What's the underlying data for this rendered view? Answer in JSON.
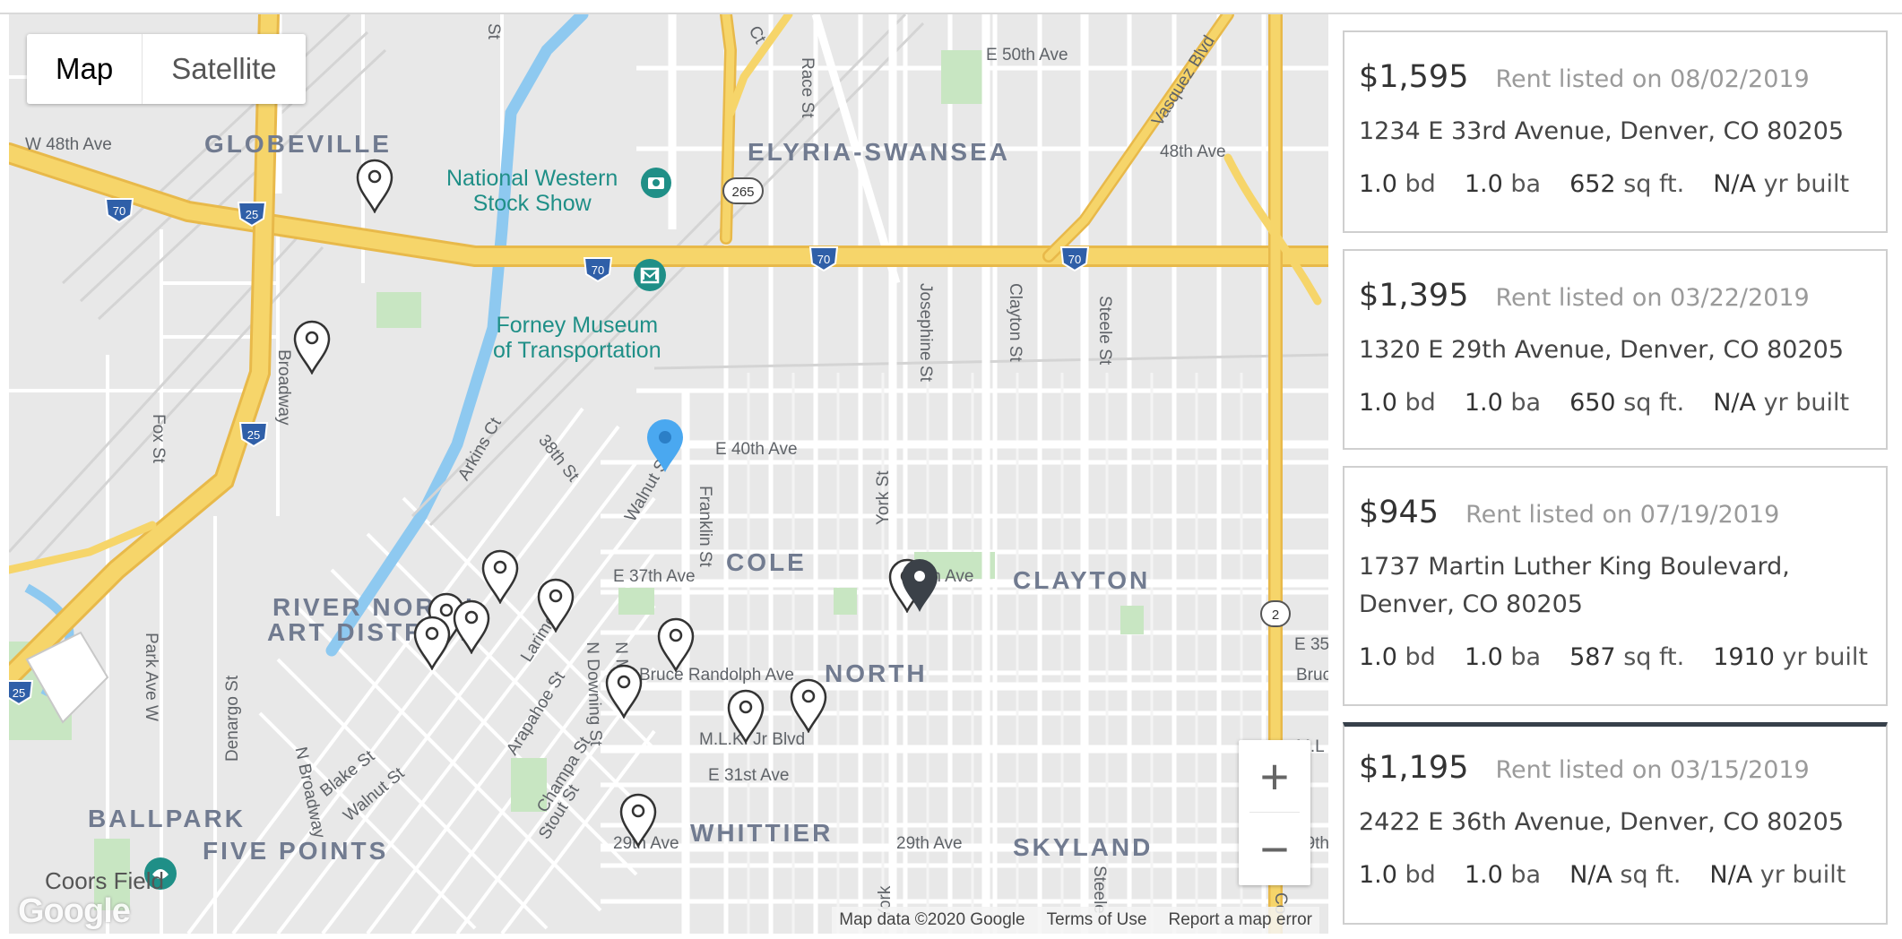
{
  "map": {
    "type_buttons": [
      "Map",
      "Satellite"
    ],
    "active_type": "Map",
    "zoom": {
      "in_label": "+",
      "out_label": "−"
    },
    "attribution": {
      "data": "Map data ©2020 Google",
      "terms": "Terms of Use",
      "report": "Report a map error"
    },
    "logo": "Google",
    "neighborhoods": {
      "globeville": "GLOBEVILLE",
      "elyria": "ELYRIA-SWANSEA",
      "cole": "COLE",
      "clayton": "CLAYTON",
      "north": "NORTH",
      "river1": "RIVER NORTH",
      "river2": "ART DISTRICT",
      "ballpark": "BALLPARK",
      "fivepoints": "FIVE POINTS",
      "whittier": "WHITTIER",
      "skyland": "SKYLAND"
    },
    "poi": {
      "nwss1": "National Western",
      "nwss2": "Stock Show",
      "forney1": "Forney Museum",
      "forney2": "of Transportation",
      "coors": "Coors Field"
    },
    "streets": {
      "e50": "E 50th Ave",
      "w48": "W 48th Ave",
      "e48": "48th Ave",
      "vasquez": "Vasquez Blvd",
      "e40": "E 40th Ave",
      "e37": "E 37th Ave",
      "e36": "th Ave",
      "bruce": "Bruce Randolph Ave",
      "mlk": "M.L.K. Jr Blvd",
      "e31": "E 31st Ave",
      "e29": "29th Ave",
      "e29b": "29th Ave",
      "e35": "E 35",
      "bruc": "Bruc",
      "mlk2": "M.L",
      "29th": "29th",
      "race": "Race St",
      "josephine": "Josephine St",
      "clayton_st": "Clayton St",
      "steele": "Steele St",
      "york": "York St",
      "york2": "York",
      "steele2": "Steele",
      "franklin": "Franklin St",
      "walnut": "Walnut St",
      "arkins": "Arkins Ct",
      "st38": "38th St",
      "broadway": "Broadway",
      "fox": "Fox St",
      "parkave": "Park Ave W",
      "denargo": "Denargo St",
      "nbroadway": "N Broadway",
      "blake": "Blake St",
      "walnut2": "Walnut St",
      "larimer": "Larimer",
      "arapahoe": "Arapahoe St",
      "champa": "Champa St",
      "stout": "Stout St",
      "ndowning": "N Downing St",
      "nm": "N M",
      "st": "St",
      "ct": "Ct",
      "co": "Co"
    },
    "shields": {
      "i70a": "70",
      "i70b": "70",
      "i70c": "70",
      "i70d": "70",
      "i25a": "25",
      "i25b": "25",
      "i25c": "25",
      "us265": "265",
      "co2": "2"
    }
  },
  "listings": [
    {
      "price": "$1,595",
      "listed": "Rent listed on 08/02/2019",
      "address": "1234 E 33rd Avenue, Denver, CO 80205",
      "bd": "1.0",
      "ba": "1.0",
      "sqft": "652",
      "year": "N/A",
      "bd_unit": "bd",
      "ba_unit": "ba",
      "sqft_unit": "sq ft.",
      "year_unit": "yr built"
    },
    {
      "price": "$1,395",
      "listed": "Rent listed on 03/22/2019",
      "address": "1320 E 29th Avenue, Denver, CO 80205",
      "bd": "1.0",
      "ba": "1.0",
      "sqft": "650",
      "year": "N/A",
      "bd_unit": "bd",
      "ba_unit": "ba",
      "sqft_unit": "sq ft.",
      "year_unit": "yr built"
    },
    {
      "price": "$945",
      "listed": "Rent listed on 07/19/2019",
      "address": "1737 Martin Luther King Boulevard, Denver, CO 80205",
      "bd": "1.0",
      "ba": "1.0",
      "sqft": "587",
      "year": "1910",
      "bd_unit": "bd",
      "ba_unit": "ba",
      "sqft_unit": "sq ft.",
      "year_unit": "yr built"
    },
    {
      "price": "$1,195",
      "listed": "Rent listed on 03/15/2019",
      "address": "2422 E 36th Avenue, Denver, CO 80205",
      "bd": "1.0",
      "ba": "1.0",
      "sqft": "N/A",
      "year": "N/A",
      "bd_unit": "bd",
      "ba_unit": "ba",
      "sqft_unit": "sq ft.",
      "year_unit": "yr built"
    }
  ],
  "colors": {
    "highway": "#f6d56a",
    "highway_edge": "#e8b94a",
    "road": "#ffffff",
    "water": "#8ec9f0",
    "park": "#c8e6c2",
    "hood_label": "#717b90",
    "pin_active": "#3b4148",
    "pin_center": "#4aa8f0",
    "card_border": "#cfcfcf"
  }
}
